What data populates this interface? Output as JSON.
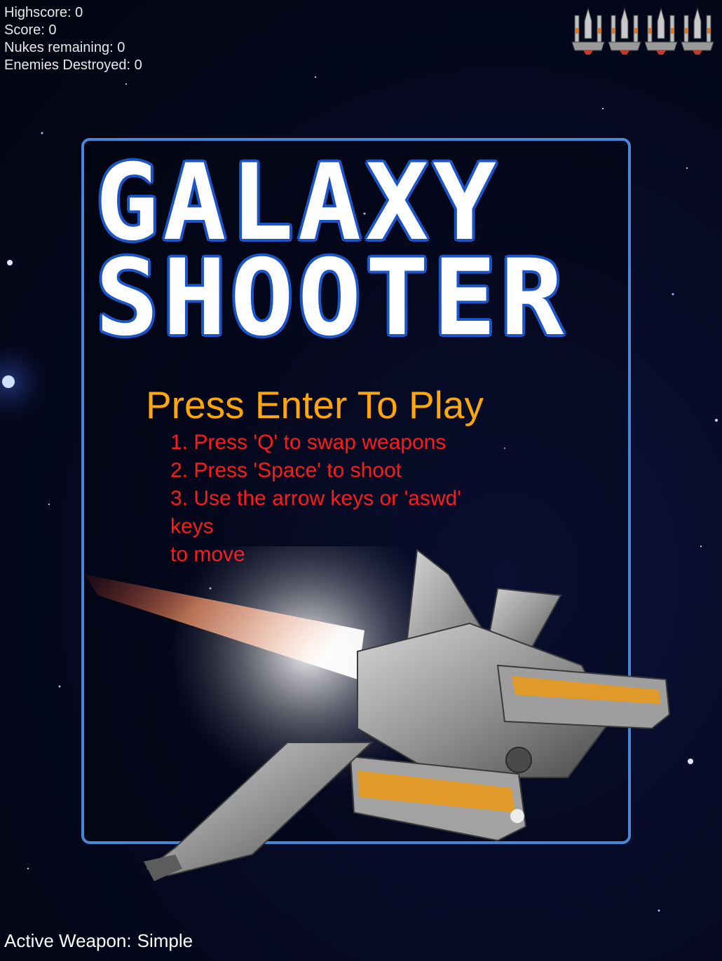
{
  "hud": {
    "highscore_label": "Highscore:",
    "highscore": "0",
    "score_label": "Score:",
    "score": "0",
    "nukes_label": "Nukes remaining:",
    "nukes": "0",
    "enemies_label": "Enemies Destroyed:",
    "enemies": "0"
  },
  "lives": {
    "count": 4,
    "icon": "ship-life-icon"
  },
  "title": {
    "line1": "GALAXY",
    "line2": "SHOOTER"
  },
  "prompt": {
    "text": "Press Enter To Play"
  },
  "instructions": [
    "1. Press 'Q' to swap weapons",
    "2. Press 'Space' to shoot",
    "3. Use the arrow keys or 'aswd'",
    "keys",
    "to move"
  ],
  "weapon": {
    "label": "Active Weapon:",
    "value": "Simple"
  },
  "colors": {
    "panel_border": "#4a86d6",
    "title_fill": "#ffffff",
    "title_outline": "#1b55c8",
    "prompt": "#ffa70a",
    "instructions": "#ff1a1a",
    "hud_text": "#e8e8e8"
  }
}
